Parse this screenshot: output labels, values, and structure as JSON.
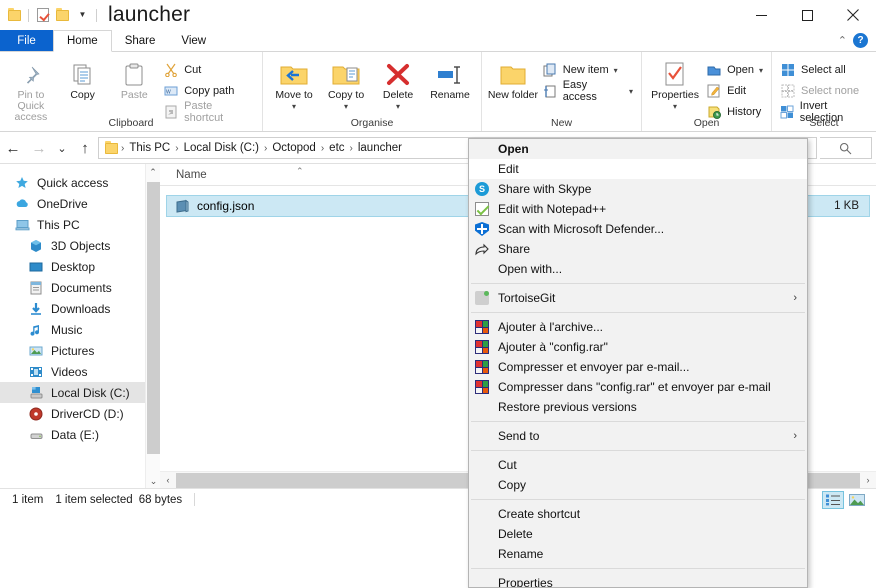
{
  "window": {
    "title": "launcher",
    "minimize_label": "—",
    "maximize_label": "□",
    "close_label": "✕",
    "collapse_ribbon_label": "⌃",
    "help_label": "?"
  },
  "quick_access": {
    "items": [
      {
        "name": "folder-icon",
        "label": ""
      },
      {
        "name": "properties-icon",
        "label": ""
      },
      {
        "name": "folder-icon-2",
        "label": ""
      },
      {
        "name": "customize-caret",
        "label": "▼"
      }
    ]
  },
  "tabs": [
    {
      "id": "file",
      "label": "File"
    },
    {
      "id": "home",
      "label": "Home"
    },
    {
      "id": "share",
      "label": "Share"
    },
    {
      "id": "view",
      "label": "View"
    }
  ],
  "ribbon": {
    "groups": [
      {
        "label": "Clipboard",
        "big": [
          {
            "label": "Pin to Quick access",
            "icon": "pin-icon",
            "dim": true
          },
          {
            "label": "Copy",
            "icon": "copy-icon",
            "dim": false
          },
          {
            "label": "Paste",
            "icon": "paste-icon",
            "dim": true
          }
        ],
        "small": [
          {
            "label": "Cut",
            "icon": "cut-icon",
            "dim": false
          },
          {
            "label": "Copy path",
            "icon": "copy-path-icon",
            "dim": false
          },
          {
            "label": "Paste shortcut",
            "icon": "paste-shortcut-icon",
            "dim": true
          }
        ]
      },
      {
        "label": "Organise",
        "big": [
          {
            "label": "Move to",
            "icon": "move-to-icon",
            "caret": "▾"
          },
          {
            "label": "Copy to",
            "icon": "copy-to-icon",
            "caret": "▾"
          },
          {
            "label": "Delete",
            "icon": "delete-icon",
            "caret": "▾"
          },
          {
            "label": "Rename",
            "icon": "rename-icon",
            "caret": ""
          }
        ]
      },
      {
        "label": "New",
        "big": [
          {
            "label": "New folder",
            "icon": "new-folder-icon"
          }
        ],
        "small": [
          {
            "label": "New item",
            "icon": "new-item-icon",
            "caret": "▾"
          },
          {
            "label": "Easy access",
            "icon": "easy-access-icon",
            "caret": "▾"
          }
        ]
      },
      {
        "label": "Open",
        "big": [
          {
            "label": "Properties",
            "icon": "properties-icon",
            "caret": "▾"
          }
        ],
        "small": [
          {
            "label": "Open",
            "icon": "open-icon",
            "caret": "▾"
          },
          {
            "label": "Edit",
            "icon": "edit-icon",
            "caret": ""
          },
          {
            "label": "History",
            "icon": "history-icon",
            "caret": ""
          }
        ]
      },
      {
        "label": "Select",
        "small": [
          {
            "label": "Select all",
            "icon": "select-all-icon"
          },
          {
            "label": "Select none",
            "icon": "select-none-icon",
            "dim": true
          },
          {
            "label": "Invert selection",
            "icon": "invert-selection-icon"
          }
        ]
      }
    ]
  },
  "address_bar": {
    "back_label": "←",
    "forward_label": "→",
    "recent_label": "⌄",
    "up_label": "↑",
    "breadcrumbs": [
      "This PC",
      "Local Disk (C:)",
      "Octopod",
      "etc",
      "launcher"
    ],
    "separator": "›",
    "search_icon": "search-icon"
  },
  "nav_pane": {
    "items": [
      {
        "label": "Quick access",
        "icon": "quick-access-star-icon",
        "indent": false,
        "selected": false
      },
      {
        "label": "OneDrive",
        "icon": "onedrive-cloud-icon",
        "indent": false,
        "selected": false
      },
      {
        "label": "This PC",
        "icon": "this-pc-icon",
        "indent": false,
        "selected": false
      },
      {
        "label": "3D Objects",
        "icon": "3d-objects-icon",
        "indent": true,
        "selected": false
      },
      {
        "label": "Desktop",
        "icon": "desktop-icon",
        "indent": true,
        "selected": false
      },
      {
        "label": "Documents",
        "icon": "documents-icon",
        "indent": true,
        "selected": false
      },
      {
        "label": "Downloads",
        "icon": "downloads-icon",
        "indent": true,
        "selected": false
      },
      {
        "label": "Music",
        "icon": "music-icon",
        "indent": true,
        "selected": false
      },
      {
        "label": "Pictures",
        "icon": "pictures-icon",
        "indent": true,
        "selected": false
      },
      {
        "label": "Videos",
        "icon": "videos-icon",
        "indent": true,
        "selected": false
      },
      {
        "label": "Local Disk (C:)",
        "icon": "local-disk-icon",
        "indent": true,
        "selected": true
      },
      {
        "label": "DriverCD (D:)",
        "icon": "drivercd-icon",
        "indent": true,
        "selected": false
      },
      {
        "label": "Data (E:)",
        "icon": "data-drive-icon",
        "indent": true,
        "selected": false
      }
    ],
    "scroll_up": "⌃",
    "scroll_down": "⌄"
  },
  "file_list": {
    "columns": [
      "Name"
    ],
    "sort_indicator": "⌃",
    "rows": [
      {
        "name": "config.json",
        "size": "1 KB",
        "icon": "json-file-icon",
        "selected": true
      }
    ],
    "scroll_left": "‹",
    "scroll_right": "›"
  },
  "status_bar": {
    "item_count": "1 item",
    "selection": "1 item selected",
    "size": "68 bytes",
    "view_details_label": "details-view-icon",
    "view_large_icons_label": "large-icons-view-icon"
  },
  "context_menu": {
    "items": [
      {
        "label": "Open",
        "bold": true,
        "icon": "",
        "submenu": false,
        "hover": false
      },
      {
        "label": "Edit",
        "bold": false,
        "icon": "",
        "submenu": false,
        "hover": true
      },
      {
        "label": "Share with Skype",
        "bold": false,
        "icon": "skype-icon",
        "submenu": false,
        "hover": false
      },
      {
        "label": "Edit with Notepad++",
        "bold": false,
        "icon": "notepadpp-icon",
        "submenu": false,
        "hover": false
      },
      {
        "label": "Scan with Microsoft Defender...",
        "bold": false,
        "icon": "defender-shield-icon",
        "submenu": false,
        "hover": false
      },
      {
        "label": "Share",
        "bold": false,
        "icon": "share-icon",
        "submenu": false,
        "hover": false
      },
      {
        "label": "Open with...",
        "bold": false,
        "icon": "",
        "submenu": false,
        "hover": false
      },
      {
        "separator": true
      },
      {
        "label": "TortoiseGit",
        "bold": false,
        "icon": "tortoisegit-icon",
        "submenu": true,
        "hover": false
      },
      {
        "separator": true
      },
      {
        "label": "Ajouter à l'archive...",
        "bold": false,
        "icon": "winrar-icon",
        "submenu": false,
        "hover": false
      },
      {
        "label": "Ajouter à \"config.rar\"",
        "bold": false,
        "icon": "winrar-icon",
        "submenu": false,
        "hover": false
      },
      {
        "label": "Compresser et envoyer par e-mail...",
        "bold": false,
        "icon": "winrar-icon",
        "submenu": false,
        "hover": false
      },
      {
        "label": "Compresser dans \"config.rar\" et envoyer par e-mail",
        "bold": false,
        "icon": "winrar-icon",
        "submenu": false,
        "hover": false
      },
      {
        "label": "Restore previous versions",
        "bold": false,
        "icon": "",
        "submenu": false,
        "hover": false
      },
      {
        "separator": true
      },
      {
        "label": "Send to",
        "bold": false,
        "icon": "",
        "submenu": true,
        "hover": false
      },
      {
        "separator": true
      },
      {
        "label": "Cut",
        "bold": false,
        "icon": "",
        "submenu": false,
        "hover": false
      },
      {
        "label": "Copy",
        "bold": false,
        "icon": "",
        "submenu": false,
        "hover": false
      },
      {
        "separator": true
      },
      {
        "label": "Create shortcut",
        "bold": false,
        "icon": "",
        "submenu": false,
        "hover": false
      },
      {
        "label": "Delete",
        "bold": false,
        "icon": "",
        "submenu": false,
        "hover": false
      },
      {
        "label": "Rename",
        "bold": false,
        "icon": "",
        "submenu": false,
        "hover": false
      },
      {
        "separator": true
      },
      {
        "label": "Properties",
        "bold": false,
        "icon": "",
        "submenu": false,
        "hover": false
      }
    ],
    "submenu_arrow": "›"
  },
  "colors": {
    "accent": "#0b63ce",
    "selection": "#cce8f4",
    "menu_bg": "#f2f2f2",
    "hover": "#ffffff"
  }
}
